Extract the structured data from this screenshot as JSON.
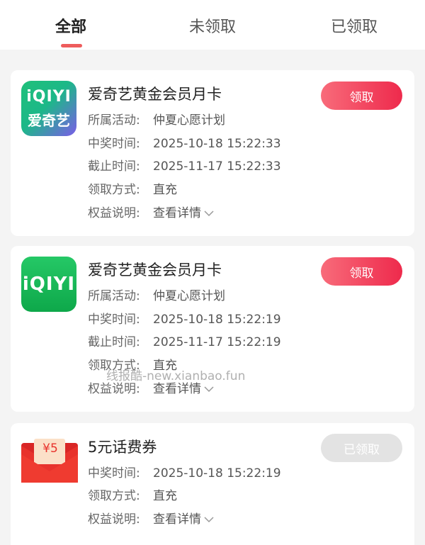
{
  "tabs": [
    {
      "label": "全部",
      "active": true
    },
    {
      "label": "未领取",
      "active": false
    },
    {
      "label": "已领取",
      "active": false
    }
  ],
  "cards": [
    {
      "logo_line1": "iQIYI",
      "logo_line2": "爱奇艺",
      "title": "爱奇艺黄金会员月卡",
      "activity_label": "所属活动:",
      "activity_value": "仲夏心愿计划",
      "win_time_label": "中奖时间:",
      "win_time_value": "2025-10-18 15:22:33",
      "deadline_label": "截止时间:",
      "deadline_value": "2025-11-17 15:22:33",
      "method_label": "领取方式:",
      "method_value": "直充",
      "benefit_label": "权益说明:",
      "benefit_value": "查看详情",
      "button_label": "领取"
    },
    {
      "logo_line1": "iQIYI",
      "title": "爱奇艺黄金会员月卡",
      "activity_label": "所属活动:",
      "activity_value": "仲夏心愿计划",
      "win_time_label": "中奖时间:",
      "win_time_value": "2025-10-18 15:22:19",
      "deadline_label": "截止时间:",
      "deadline_value": "2025-11-17 15:22:19",
      "method_label": "领取方式:",
      "method_value": "直充",
      "benefit_label": "权益说明:",
      "benefit_value": "查看详情",
      "button_label": "领取"
    },
    {
      "coupon_value": "¥5",
      "title": "5元话费券",
      "win_time_label": "中奖时间:",
      "win_time_value": "2025-10-18 15:22:19",
      "method_label": "领取方式:",
      "method_value": "直充",
      "benefit_label": "权益说明:",
      "benefit_value": "查看详情",
      "button_label": "已领取"
    }
  ],
  "watermark": "线报酷-new.xianbao.fun",
  "colors": {
    "accent": "#ee2a4c",
    "tab_indicator": "#ee5c5c",
    "iqiyi_green": "#1cb85c",
    "coupon_red": "#e8322c",
    "disabled_button": "#e3e3e3"
  }
}
